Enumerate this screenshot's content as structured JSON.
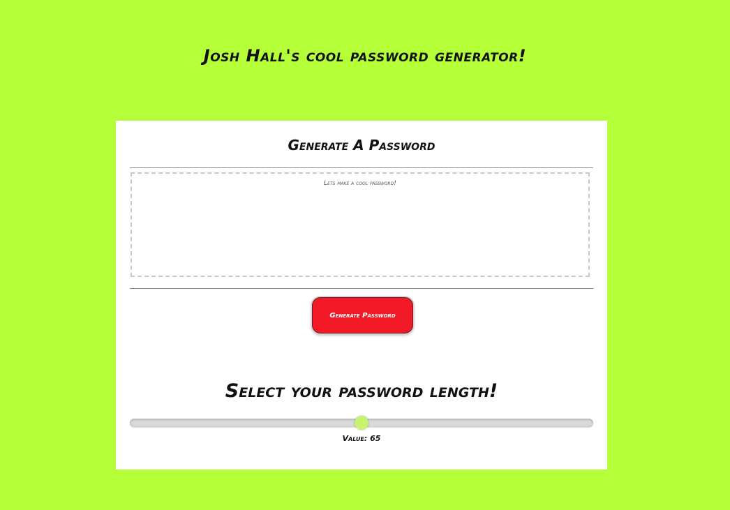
{
  "page": {
    "title": "Josh Hall's cool password generator!"
  },
  "card": {
    "header_title": "Generate A Password",
    "password_placeholder": "Lets make a cool password!",
    "password_value": "",
    "generate_button_label": "Generate Password"
  },
  "length_selector": {
    "title": "Select your password length!",
    "value_label": "Value:",
    "value": 65,
    "fraction": 0.5
  },
  "colors": {
    "background": "#b4ff38",
    "button": "#f21a26",
    "slider_thumb": "#c7f36e"
  }
}
